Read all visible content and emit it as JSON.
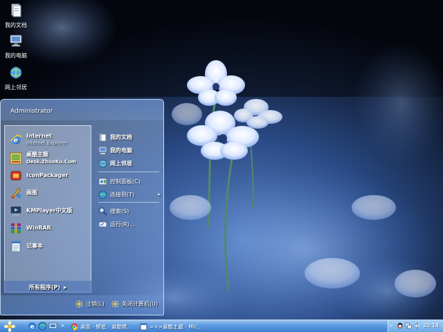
{
  "desktop": {
    "icons": [
      {
        "label": "我的文档",
        "icon": "my-documents-icon"
      },
      {
        "label": "我的电脑",
        "icon": "my-computer-icon"
      },
      {
        "label": "网上邻居",
        "icon": "network-places-icon"
      }
    ]
  },
  "start_menu": {
    "user": "Administrator",
    "programs": [
      {
        "name": "Internet",
        "sub": "Internet Explorer",
        "icon": "internet-explorer-icon"
      },
      {
        "name": "桌酷主题",
        "sub": "Desk.ZhuoKu.Com",
        "icon": "zhuoku-icon"
      },
      {
        "name": "IconPackager",
        "sub": "",
        "icon": "iconpackager-icon"
      },
      {
        "name": "画图",
        "sub": "",
        "icon": "paint-icon"
      },
      {
        "name": "KMPlayer中文版",
        "sub": "",
        "icon": "kmplayer-icon"
      },
      {
        "name": "WinRAR",
        "sub": "",
        "icon": "winrar-icon"
      },
      {
        "name": "记事本",
        "sub": "",
        "icon": "notepad-icon"
      }
    ],
    "all_programs": "所有程序(P)",
    "places": [
      {
        "label": "我的文档",
        "icon": "my-documents-icon"
      },
      {
        "label": "我的电脑",
        "icon": "my-computer-icon"
      },
      {
        "label": "网上邻居",
        "icon": "network-places-icon"
      },
      {
        "label": "控制面板(C)",
        "icon": "control-panel-icon"
      },
      {
        "label": "连接到(T)",
        "icon": "connect-to-icon",
        "arrow": "▸"
      },
      {
        "label": "搜索(S)",
        "icon": "search-icon"
      },
      {
        "label": "运行(R)...",
        "icon": "run-icon"
      }
    ],
    "logoff": "注销(L)",
    "shutdown": "关闭计算机(U)"
  },
  "taskbar": {
    "tasks": [
      {
        "label": "桌面 - 壁纸 - 桌酷壁...",
        "icon": "chrome-icon"
      },
      {
        "label": "=>>桌酷主题 - Mic...",
        "icon": "window-icon"
      }
    ],
    "clock": "20:14"
  },
  "colors": {
    "taskbar": "#3f7fd1",
    "menu_border": "#d2e6ff"
  }
}
